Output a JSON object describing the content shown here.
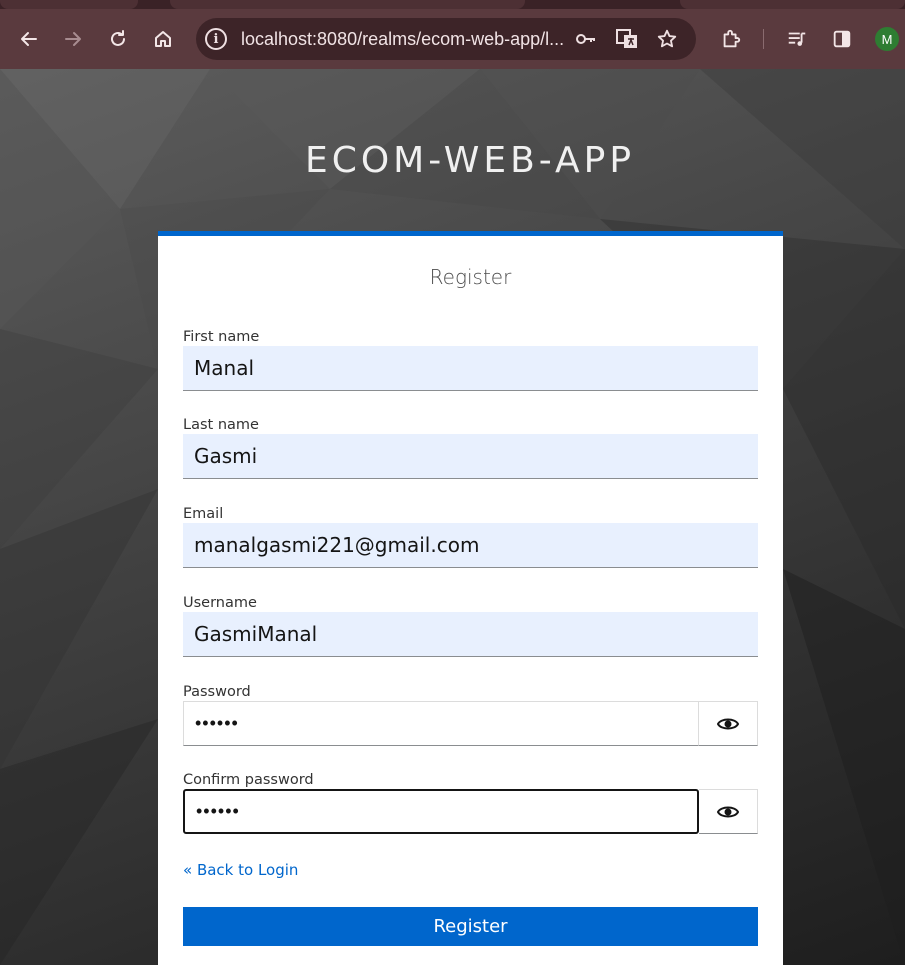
{
  "browser": {
    "url": "localhost:8080/realms/ecom-web-app/l...",
    "profile_initial": "M"
  },
  "page": {
    "realm_title": "ECOM-WEB-APP"
  },
  "form": {
    "title": "Register",
    "fields": [
      {
        "label": "First name",
        "value": "Manal"
      },
      {
        "label": "Last name",
        "value": "Gasmi"
      },
      {
        "label": "Email",
        "value": "manalgasmi221@gmail.com"
      },
      {
        "label": "Username",
        "value": "GasmiManal"
      }
    ],
    "password": {
      "label": "Password",
      "masked_value": "••••••"
    },
    "confirm_password": {
      "label": "Confirm password",
      "masked_value": "••••••"
    },
    "back_link": "« Back to Login",
    "submit_label": "Register"
  },
  "colors": {
    "accent": "#0066cc",
    "autofill_bg": "#e8f0fe",
    "toolbar_bg": "#5a3a3e"
  }
}
